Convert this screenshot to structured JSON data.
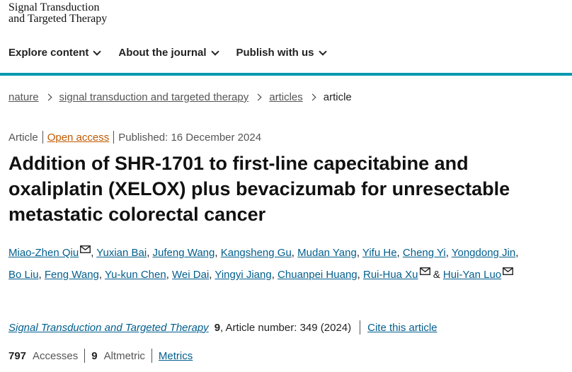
{
  "header": {
    "logo_line1": "Signal Transduction",
    "logo_line2": "and Targeted Therapy"
  },
  "nav": [
    {
      "label": "Explore content"
    },
    {
      "label": "About the journal"
    },
    {
      "label": "Publish with us"
    }
  ],
  "colors": {
    "accent_rule": "#0099b0",
    "link": "#025e8d",
    "open_access": "#c05a00"
  },
  "breadcrumb": [
    "nature",
    "signal transduction and targeted therapy",
    "articles",
    "article"
  ],
  "article_meta": {
    "type": "Article",
    "open_access": "Open access",
    "published": "Published: 16 December 2024"
  },
  "title": "Addition of SHR-1701 to first-line capecitabine and oxaliplatin (XELOX) plus bevacizumab for unresectable metastatic colorectal cancer",
  "authors": [
    {
      "name": "Miao-Zhen Qiu",
      "email_icon": true
    },
    {
      "name": "Yuxian Bai"
    },
    {
      "name": "Jufeng Wang"
    },
    {
      "name": "Kangsheng Gu"
    },
    {
      "name": "Mudan Yang"
    },
    {
      "name": "Yifu He"
    },
    {
      "name": "Cheng Yi"
    },
    {
      "name": "Yongdong Jin"
    },
    {
      "name": "Bo Liu"
    },
    {
      "name": "Feng Wang"
    },
    {
      "name": "Yu-kun Chen"
    },
    {
      "name": "Wei Dai"
    },
    {
      "name": "Yingyi Jiang"
    },
    {
      "name": "Chuanpei Huang"
    },
    {
      "name": "Rui-Hua Xu",
      "email_icon": true
    },
    {
      "name": "Hui-Yan Luo",
      "email_icon": true
    }
  ],
  "citation": {
    "journal": "Signal Transduction and Targeted Therapy",
    "volume": "9",
    "rest": ", Article number: 349 (2024)",
    "cite_link": "Cite this article"
  },
  "metrics": {
    "accesses_value": "797",
    "accesses_label": "Accesses",
    "altmetric_value": "9",
    "altmetric_label": "Altmetric",
    "metrics_link": "Metrics"
  }
}
